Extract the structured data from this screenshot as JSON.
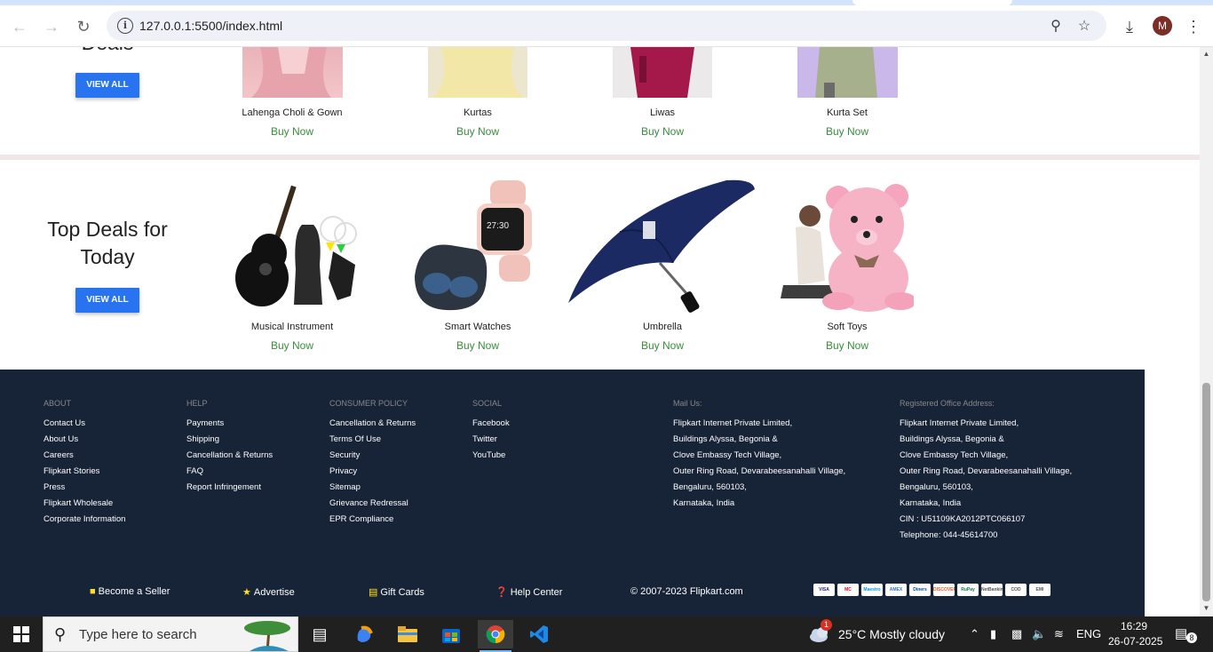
{
  "browser": {
    "url": "127.0.0.1:5500/index.html",
    "avatar_letter": "M"
  },
  "page": {
    "section1": {
      "title_partial": "Deals",
      "view_all": "VIEW ALL",
      "products": [
        {
          "name": "Lahenga Choli & Gown",
          "cta": "Buy Now"
        },
        {
          "name": "Kurtas",
          "cta": "Buy Now"
        },
        {
          "name": "Liwas",
          "cta": "Buy Now"
        },
        {
          "name": "Kurta Set",
          "cta": "Buy Now"
        }
      ]
    },
    "section2": {
      "title": "Top Deals for Today",
      "view_all": "VIEW ALL",
      "products": [
        {
          "name": "Musical Instrument",
          "cta": "Buy Now"
        },
        {
          "name": "Smart Watches",
          "cta": "Buy Now"
        },
        {
          "name": "Umbrella",
          "cta": "Buy Now"
        },
        {
          "name": "Soft Toys",
          "cta": "Buy Now"
        }
      ]
    }
  },
  "footer": {
    "columns": [
      {
        "heading": "ABOUT",
        "links": [
          "Contact Us",
          "About Us",
          "Careers",
          "Flipkart Stories",
          "Press",
          "Flipkart Wholesale",
          "Corporate Information"
        ]
      },
      {
        "heading": "HELP",
        "links": [
          "Payments",
          "Shipping",
          "Cancellation & Returns",
          "FAQ",
          "Report Infringement"
        ]
      },
      {
        "heading": "CONSUMER POLICY",
        "links": [
          "Cancellation & Returns",
          "Terms Of Use",
          "Security",
          "Privacy",
          "Sitemap",
          "Grievance Redressal",
          "EPR Compliance"
        ]
      },
      {
        "heading": "SOCIAL",
        "links": [
          "Facebook",
          "Twitter",
          "YouTube"
        ]
      },
      {
        "heading": "Mail Us:",
        "links": [
          "Flipkart Internet Private Limited,",
          "Buildings Alyssa, Begonia &",
          "Clove Embassy Tech Village,",
          "Outer Ring Road, Devarabeesanahalli Village,",
          "Bengaluru, 560103,",
          "Karnataka, India"
        ]
      },
      {
        "heading": "Registered Office Address:",
        "links": [
          "Flipkart Internet Private Limited,",
          "Buildings Alyssa, Begonia &",
          "Clove Embassy Tech Village,",
          "Outer Ring Road, Devarabeesanahalli Village,",
          "Bengaluru, 560103,",
          "Karnataka, India",
          "CIN : U51109KA2012PTC066107",
          "Telephone: 044-45614700"
        ]
      }
    ],
    "bottom": {
      "seller": "Become a Seller",
      "advertise": "Advertise",
      "gift": "Gift Cards",
      "help": "Help Center",
      "copyright": "© 2007-2023 Flipkart.com"
    },
    "payment_methods": [
      "VISA",
      "MC",
      "Maestro",
      "AMEX",
      "Diners",
      "DISCOVER",
      "RuPay",
      "NetBanking",
      "COD",
      "EMI"
    ]
  },
  "taskbar": {
    "search_placeholder": "Type here to search",
    "weather_badge": "1",
    "weather": "25°C  Mostly cloudy",
    "language": "ENG",
    "time": "16:29",
    "date": "26-07-2025",
    "notification_count": "8"
  }
}
